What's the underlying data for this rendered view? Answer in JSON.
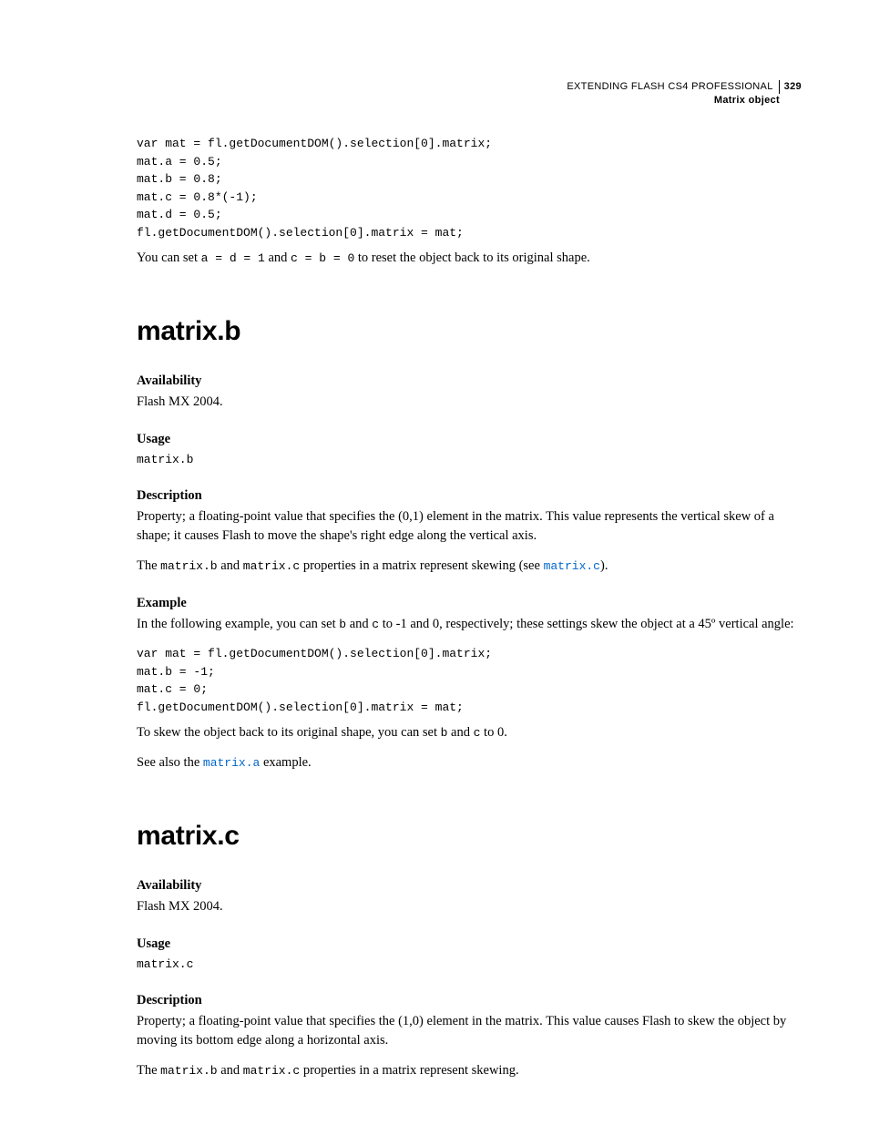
{
  "header": {
    "title": "EXTENDING FLASH CS4 PROFESSIONAL",
    "page_number": "329",
    "subtitle": "Matrix object"
  },
  "intro": {
    "code": "var mat = fl.getDocumentDOM().selection[0].matrix;\nmat.a = 0.5;\nmat.b = 0.8;\nmat.c = 0.8*(-1);\nmat.d = 0.5;\nfl.getDocumentDOM().selection[0].matrix = mat;",
    "text_lead": "You can set ",
    "code_a": "a = d = 1",
    "text_mid": " and ",
    "code_b": "c = b = 0",
    "text_tail": " to reset the object back to its original shape."
  },
  "matrix_b": {
    "heading": "matrix.b",
    "availability_h": "Availability",
    "availability_t": "Flash MX 2004.",
    "usage_h": "Usage",
    "usage_code": "matrix.b",
    "description_h": "Description",
    "description_p1": "Property; a floating-point value that specifies the (0,1) element in the matrix. This value represents the vertical skew of a shape; it causes Flash to move the shape's right edge along the vertical axis.",
    "desc2_lead": "The ",
    "desc2_code1": "matrix.b",
    "desc2_mid1": " and ",
    "desc2_code2": "matrix.c",
    "desc2_mid2": " properties in a matrix represent skewing (see ",
    "desc2_link": "matrix.c",
    "desc2_tail": ").",
    "example_h": "Example",
    "example_intro_lead": "In the following example, you can set ",
    "example_intro_code1": "b",
    "example_intro_mid1": " and ",
    "example_intro_code2": "c",
    "example_intro_tail": " to -1 and 0, respectively; these settings skew the object at a 45º vertical angle:",
    "example_code": "var mat = fl.getDocumentDOM().selection[0].matrix;\nmat.b = -1;\nmat.c = 0;\nfl.getDocumentDOM().selection[0].matrix = mat;",
    "after_lead": "To skew the object back to its original shape, you can set ",
    "after_code1": "b",
    "after_mid": " and ",
    "after_code2": "c",
    "after_tail": " to 0.",
    "seealso_lead": "See also the ",
    "seealso_link": "matrix.a",
    "seealso_tail": " example."
  },
  "matrix_c": {
    "heading": "matrix.c",
    "availability_h": "Availability",
    "availability_t": "Flash MX 2004.",
    "usage_h": "Usage",
    "usage_code": "matrix.c",
    "description_h": "Description",
    "description_p1": "Property; a floating-point value that specifies the (1,0) element in the matrix. This value causes Flash to skew the object by moving its bottom edge along a horizontal axis.",
    "desc2_lead": "The ",
    "desc2_code1": "matrix.b",
    "desc2_mid1": " and ",
    "desc2_code2": "matrix.c",
    "desc2_tail": " properties in a matrix represent skewing."
  }
}
